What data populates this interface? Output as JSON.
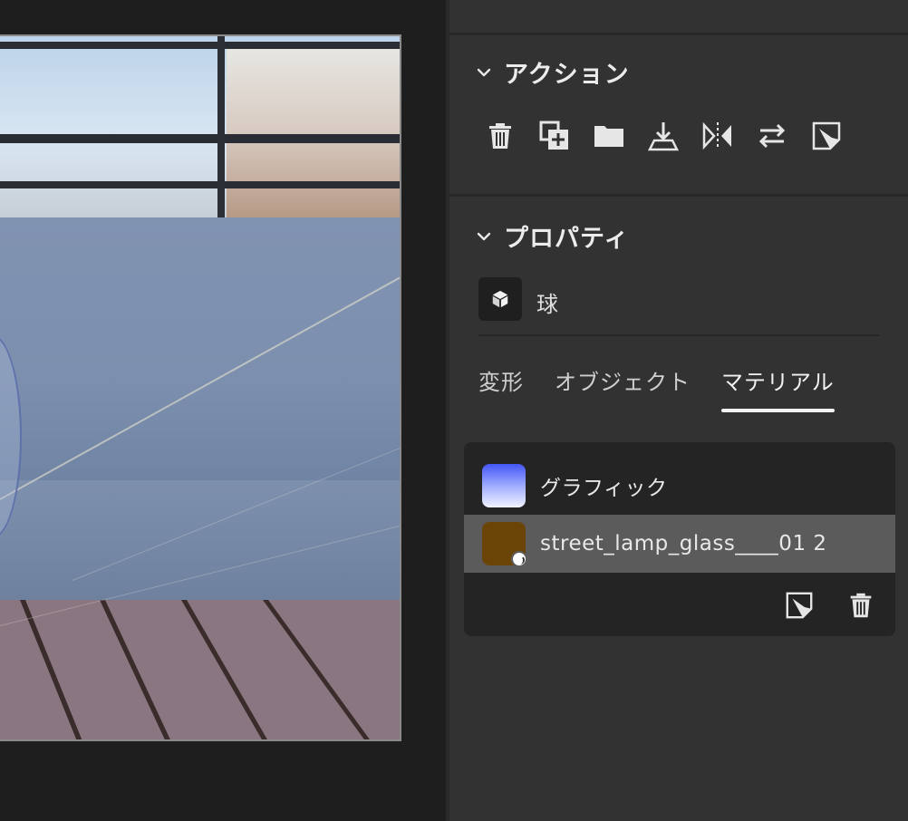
{
  "sections": {
    "actions": {
      "title": "アクション"
    },
    "properties": {
      "title": "プロパティ"
    }
  },
  "actions": [
    {
      "name": "delete",
      "icon": "trash-icon"
    },
    {
      "name": "duplicate",
      "icon": "duplicate-add-icon"
    },
    {
      "name": "group",
      "icon": "folder-icon"
    },
    {
      "name": "drop-to-ground",
      "icon": "drop-to-ground-icon"
    },
    {
      "name": "mirror",
      "icon": "mirror-icon"
    },
    {
      "name": "swap",
      "icon": "swap-arrows-icon"
    },
    {
      "name": "decal",
      "icon": "decal-icon"
    }
  ],
  "object": {
    "type_icon": "cube-icon",
    "name": "球"
  },
  "tabs": [
    {
      "label": "変形",
      "active": false
    },
    {
      "label": "オブジェクト",
      "active": false
    },
    {
      "label": "マテリアル",
      "active": true
    }
  ],
  "materials": [
    {
      "name": "グラフィック",
      "swatch": "#6b7cff",
      "selected": false
    },
    {
      "name": "street_lamp_glass____01 2",
      "swatch": "#6a4507",
      "selected": true
    }
  ],
  "material_actions": [
    {
      "name": "decal",
      "icon": "decal-icon"
    },
    {
      "name": "delete",
      "icon": "trash-icon"
    }
  ],
  "colors": {
    "panel_bg": "#323232",
    "selected_row": "#5b5b5b",
    "accent": "#f2f2f2"
  }
}
